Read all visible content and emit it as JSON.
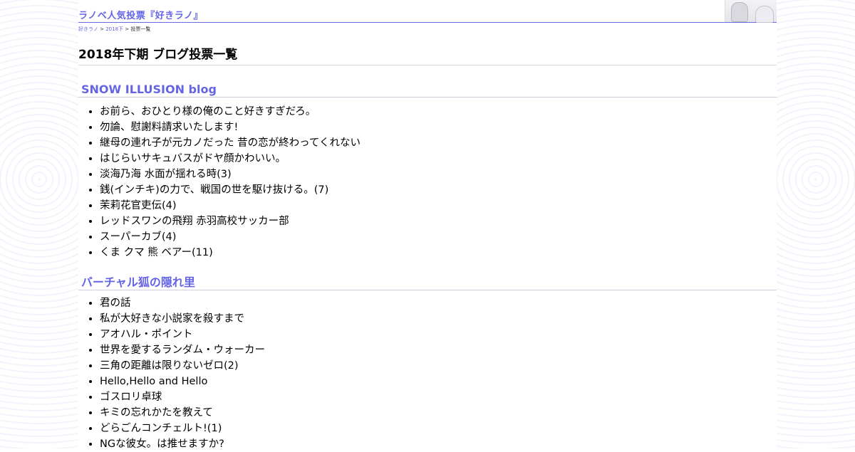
{
  "site": {
    "title": "ラノベ人気投票『好きラノ』"
  },
  "breadcrumb": {
    "home": "好きラノ",
    "sep1": " > ",
    "period": "2018下",
    "sep2": " > ",
    "current": "投票一覧"
  },
  "page": {
    "title": "2018年下期 ブログ投票一覧"
  },
  "sections": [
    {
      "title": "SNOW ILLUSION blog",
      "items": [
        "お前ら、おひとり様の俺のこと好きすぎだろ。",
        "勿論、慰謝料請求いたします!",
        "継母の連れ子が元カノだった 昔の恋が終わってくれない",
        "はじらいサキュバスがドヤ顔かわいい。",
        "淡海乃海 水面が揺れる時(3)",
        "銭(インチキ)の力で、戦国の世を駆け抜ける。(7)",
        "茉莉花官吏伝(4)",
        "レッドスワンの飛翔 赤羽高校サッカー部",
        "スーパーカブ(4)",
        "くま クマ 熊 ベアー(11)"
      ]
    },
    {
      "title": "バーチャル狐の隠れ里",
      "items": [
        "君の話",
        "私が大好きな小説家を殺すまで",
        "アオハル・ポイント",
        "世界を愛するランダム・ウォーカー",
        "三角の距離は限りないゼロ(2)",
        "Hello,Hello and Hello",
        "ゴスロリ卓球",
        "キミの忘れかたを教えて",
        "どらごんコンチェルト!(1)",
        "NGな彼女。は推せますか?"
      ]
    }
  ],
  "colors": {
    "accent": "#6464e6",
    "rule": "#d8d8d8"
  }
}
